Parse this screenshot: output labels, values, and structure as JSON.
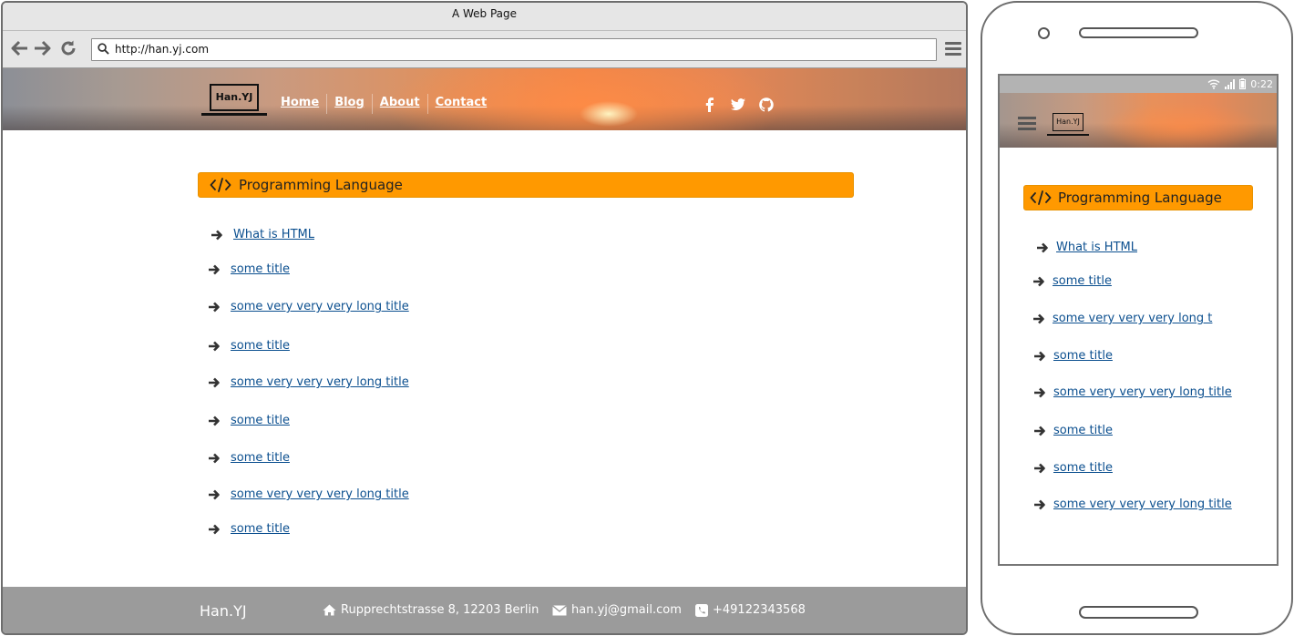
{
  "browser": {
    "title": "A Web Page",
    "url": "http://han.yj.com"
  },
  "site": {
    "logo_text": "Han.YJ",
    "nav": [
      {
        "label": "Home"
      },
      {
        "label": "Blog"
      },
      {
        "label": "About"
      },
      {
        "label": "Contact"
      }
    ],
    "social": [
      "facebook-icon",
      "twitter-icon",
      "github-icon"
    ],
    "section_title": "Programming Language",
    "links": [
      "What is HTML",
      "some title",
      "some very very very long title",
      "some title",
      "some very very very long title",
      "some title",
      "some title",
      "some very very very long title",
      "some title"
    ],
    "footer": {
      "brand": "Han.YJ",
      "address": "Rupprechtstrasse 8, 12203 Berlin",
      "email": "han.yj@gmail.com",
      "phone": "+49122343568"
    }
  },
  "mobile": {
    "time": "0:22",
    "logo_text": "Han.YJ",
    "section_title": "Programming Language",
    "links": [
      "What is HTML",
      "some title",
      "some very very very long t",
      "some title",
      "some very very very long title",
      "some title",
      "some title",
      "some very very very long title"
    ]
  },
  "colors": {
    "accent": "#ff9900",
    "link": "#0b4f8f",
    "footer_bg": "#9b9b9b"
  }
}
